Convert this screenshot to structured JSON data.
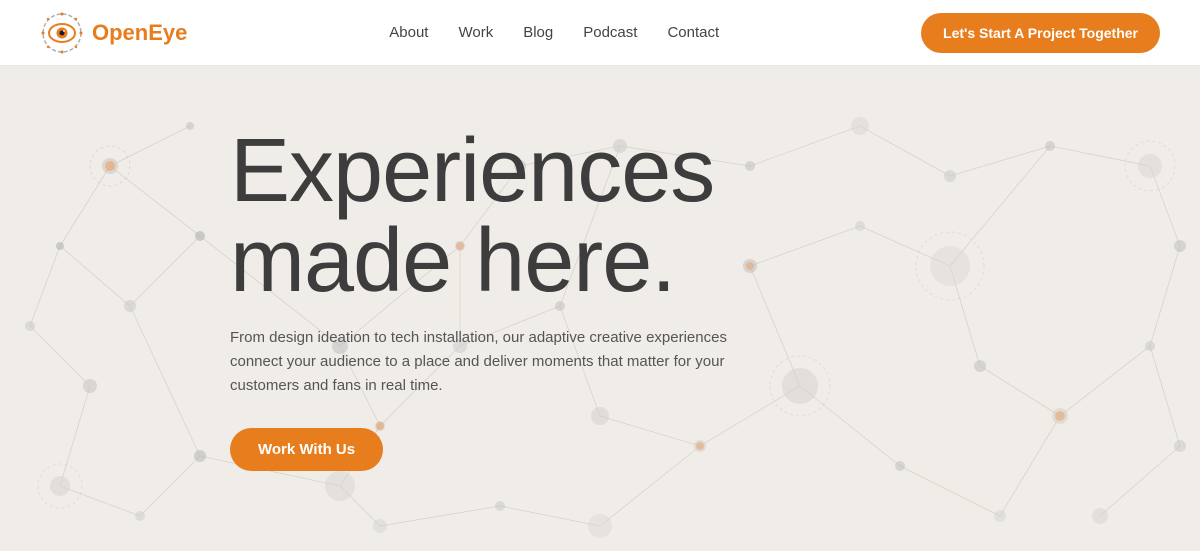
{
  "header": {
    "logo_text": "OpenEye",
    "nav_items": [
      {
        "label": "About",
        "href": "#"
      },
      {
        "label": "Work",
        "href": "#"
      },
      {
        "label": "Blog",
        "href": "#"
      },
      {
        "label": "Podcast",
        "href": "#"
      },
      {
        "label": "Contact",
        "href": "#"
      }
    ],
    "cta_label": "Let's Start A Project Together"
  },
  "hero": {
    "headline_line1": "Experiences",
    "headline_line2": "made here.",
    "subtext": "From design ideation to tech installation, our adaptive creative experiences connect your audience to a place and deliver moments that matter for your customers and fans in real time.",
    "cta_label": "Work With Us"
  },
  "colors": {
    "orange": "#e87d1e",
    "dark_text": "#3d3d3d",
    "bg": "#f0ede8"
  }
}
